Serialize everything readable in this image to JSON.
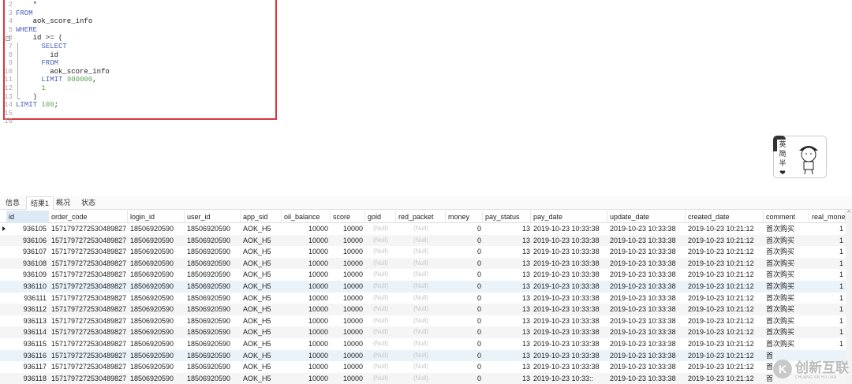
{
  "editor": {
    "lines": [
      {
        "n": "2",
        "parts": [
          [
            "",
            "    *"
          ]
        ]
      },
      {
        "n": "3",
        "parts": [
          [
            "kw",
            "FROM"
          ]
        ]
      },
      {
        "n": "4",
        "parts": [
          [
            "",
            "    aok_score_info"
          ]
        ]
      },
      {
        "n": "5",
        "parts": [
          [
            "kw",
            "WHERE"
          ]
        ]
      },
      {
        "n": "6",
        "parts": [
          [
            "",
            "    id >= ("
          ]
        ]
      },
      {
        "n": "7",
        "parts": [
          [
            "kw",
            "      SELECT"
          ]
        ]
      },
      {
        "n": "8",
        "parts": [
          [
            "",
            "        id"
          ]
        ]
      },
      {
        "n": "9",
        "parts": [
          [
            "kw",
            "      FROM"
          ]
        ]
      },
      {
        "n": "10",
        "parts": [
          [
            "",
            "        aok_score_info"
          ]
        ]
      },
      {
        "n": "11",
        "parts": [
          [
            "kw",
            "      LIMIT "
          ],
          [
            "num",
            "900000"
          ],
          [
            "",
            ","
          ]
        ]
      },
      {
        "n": "12",
        "parts": [
          [
            "num",
            "      1"
          ]
        ]
      },
      {
        "n": "13",
        "parts": [
          [
            "",
            "    )"
          ]
        ]
      },
      {
        "n": "14",
        "parts": [
          [
            "kw",
            "LIMIT "
          ],
          [
            "num",
            "100"
          ],
          [
            "",
            ";"
          ]
        ]
      },
      {
        "n": "15",
        "parts": [
          [
            "",
            ""
          ]
        ]
      },
      {
        "n": "16",
        "parts": [
          [
            "",
            ""
          ]
        ]
      }
    ],
    "fold_icon": "minus-box"
  },
  "mascot": {
    "text": [
      "英",
      "简",
      "半"
    ],
    "heart": "❤"
  },
  "tabs": [
    {
      "label": "信息"
    },
    {
      "label": "结果1",
      "active": true
    },
    {
      "label": "概况"
    },
    {
      "label": "状态"
    }
  ],
  "columns": [
    "id",
    "order_code",
    "login_id",
    "user_id",
    "app_sid",
    "oil_balance",
    "score",
    "gold",
    "red_packet",
    "money",
    "pay_status",
    "pay_date",
    "update_date",
    "created_date",
    "comment",
    "real_mone"
  ],
  "rows": [
    [
      "936105",
      "1571797272530489827",
      "18506920590",
      "18506920590",
      "AOK_H5",
      "10000",
      "10000",
      "(Null)",
      "(Null)",
      "0",
      "13",
      "2019-10-23 10:33:38",
      "2019-10-23 10:33:38",
      "2019-10-23 10:21:12",
      "首次购买",
      "1"
    ],
    [
      "936106",
      "1571797272530489827",
      "18506920590",
      "18506920590",
      "AOK_H5",
      "10000",
      "10000",
      "(Null)",
      "(Null)",
      "0",
      "13",
      "2019-10-23 10:33:38",
      "2019-10-23 10:33:38",
      "2019-10-23 10:21:12",
      "首次购买",
      "1"
    ],
    [
      "936107",
      "1571797272530489827",
      "18506920590",
      "18506920590",
      "AOK_H5",
      "10000",
      "10000",
      "(Null)",
      "(Null)",
      "0",
      "13",
      "2019-10-23 10:33:38",
      "2019-10-23 10:33:38",
      "2019-10-23 10:21:12",
      "首次购买",
      "1"
    ],
    [
      "936108",
      "1571797272530489827",
      "18506920590",
      "18506920590",
      "AOK_H5",
      "10000",
      "10000",
      "(Null)",
      "(Null)",
      "0",
      "13",
      "2019-10-23 10:33:38",
      "2019-10-23 10:33:38",
      "2019-10-23 10:21:12",
      "首次购买",
      "1"
    ],
    [
      "936109",
      "1571797272530489827",
      "18506920590",
      "18506920590",
      "AOK_H5",
      "10000",
      "10000",
      "(Null)",
      "(Null)",
      "0",
      "13",
      "2019-10-23 10:33:38",
      "2019-10-23 10:33:38",
      "2019-10-23 10:21:12",
      "首次购买",
      "1"
    ],
    [
      "936110",
      "1571797272530489827",
      "18506920590",
      "18506920590",
      "AOK_H5",
      "10000",
      "10000",
      "(Null)",
      "(Null)",
      "0",
      "13",
      "2019-10-23 10:33:38",
      "2019-10-23 10:33:38",
      "2019-10-23 10:21:12",
      "首次购买",
      "1"
    ],
    [
      "936111",
      "1571797272530489827",
      "18506920590",
      "18506920590",
      "AOK_H5",
      "10000",
      "10000",
      "(Null)",
      "(Null)",
      "0",
      "13",
      "2019-10-23 10:33:38",
      "2019-10-23 10:33:38",
      "2019-10-23 10:21:12",
      "首次购买",
      "1"
    ],
    [
      "936112",
      "1571797272530489827",
      "18506920590",
      "18506920590",
      "AOK_H5",
      "10000",
      "10000",
      "(Null)",
      "(Null)",
      "0",
      "13",
      "2019-10-23 10:33:38",
      "2019-10-23 10:33:38",
      "2019-10-23 10:21:12",
      "首次购买",
      "1"
    ],
    [
      "936113",
      "1571797272530489827",
      "18506920590",
      "18506920590",
      "AOK_H5",
      "10000",
      "10000",
      "(Null)",
      "(Null)",
      "0",
      "13",
      "2019-10-23 10:33:38",
      "2019-10-23 10:33:38",
      "2019-10-23 10:21:12",
      "首次购买",
      "1"
    ],
    [
      "936114",
      "1571797272530489827",
      "18506920590",
      "18506920590",
      "AOK_H5",
      "10000",
      "10000",
      "(Null)",
      "(Null)",
      "0",
      "13",
      "2019-10-23 10:33:38",
      "2019-10-23 10:33:38",
      "2019-10-23 10:21:12",
      "首次购买",
      "1"
    ],
    [
      "936115",
      "1571797272530489827",
      "18506920590",
      "18506920590",
      "AOK_H5",
      "10000",
      "10000",
      "(Null)",
      "(Null)",
      "0",
      "13",
      "2019-10-23 10:33:38",
      "2019-10-23 10:33:38",
      "2019-10-23 10:21:12",
      "首次购买",
      "1"
    ],
    [
      "936116",
      "1571797272530489827",
      "18506920590",
      "18506920590",
      "AOK_H5",
      "10000",
      "10000",
      "(Null)",
      "(Null)",
      "0",
      "13",
      "2019-10-23 10:33:38",
      "2019-10-23 10:33:38",
      "2019-10-23 10:21:12",
      "首",
      ""
    ],
    [
      "936117",
      "1571797272530489827",
      "18506920590",
      "18506920590",
      "AOK_H5",
      "10000",
      "10000",
      "(Null)",
      "(Null)",
      "0",
      "13",
      "2019-10-23 10:33:38",
      "2019-10-23 10:33:38",
      "2019-10-23 10:21:12",
      "首",
      ""
    ],
    [
      "936118",
      "1571797272530489827",
      "18506920590",
      "18506920590",
      "AOK_H5",
      "10000",
      "10000",
      "(Null)",
      "(Null)",
      "0",
      "13",
      "2019-10-23 10:33::",
      "2019-10-23 10:33:38",
      "2019-10-23 10:21:12",
      "首",
      ""
    ]
  ],
  "watermark": {
    "logo": "K",
    "text": "创新互联",
    "sub": "CHUANG XIN HU LIAN"
  }
}
